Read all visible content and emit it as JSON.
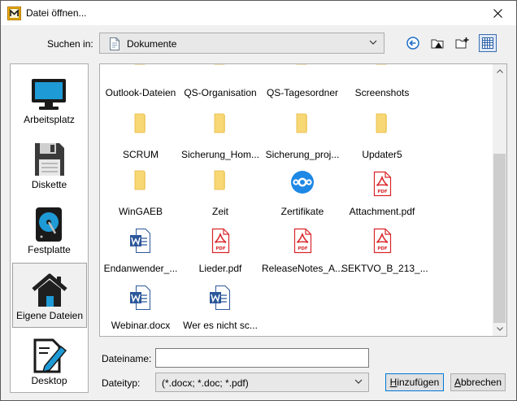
{
  "window": {
    "title": "Datei öffnen..."
  },
  "lookin": {
    "label": "Suchen in:",
    "value": "Dokumente"
  },
  "places": [
    {
      "label": "Arbeitsplatz",
      "icon": "monitor-icon"
    },
    {
      "label": "Diskette",
      "icon": "floppy-disk-icon"
    },
    {
      "label": "Festplatte",
      "icon": "hard-disk-icon"
    },
    {
      "label": "Eigene Dateien",
      "icon": "home-icon",
      "selected": true
    },
    {
      "label": "Desktop",
      "icon": "desktop-pen-icon"
    }
  ],
  "files": [
    {
      "name": "Outlook-Dateien",
      "type": "folder"
    },
    {
      "name": "QS-Organisation",
      "type": "folder"
    },
    {
      "name": "QS-Tagesordner",
      "type": "folder"
    },
    {
      "name": "Screenshots",
      "type": "folder"
    },
    {
      "name": "SCRUM",
      "type": "folder"
    },
    {
      "name": "Sicherung_Hom...",
      "type": "folder"
    },
    {
      "name": "Sicherung_proj...",
      "type": "folder"
    },
    {
      "name": "Updater5",
      "type": "folder"
    },
    {
      "name": "WinGAEB",
      "type": "folder"
    },
    {
      "name": "Zeit",
      "type": "folder"
    },
    {
      "name": "Zertifikate",
      "type": "app"
    },
    {
      "name": "Attachment.pdf",
      "type": "pdf"
    },
    {
      "name": "Endanwender_...",
      "type": "word"
    },
    {
      "name": "Lieder.pdf",
      "type": "pdf"
    },
    {
      "name": "ReleaseNotes_A...",
      "type": "pdf"
    },
    {
      "name": "SEKTVO_B_213_...",
      "type": "pdf"
    },
    {
      "name": "Webinar.docx",
      "type": "word"
    },
    {
      "name": "Wer es nicht sc...",
      "type": "word"
    }
  ],
  "filename": {
    "label": "Dateiname:",
    "value": ""
  },
  "filetype": {
    "label": "Dateityp:",
    "value": "(*.docx; *.doc; *.pdf)"
  },
  "buttons": {
    "add_hotkey": "H",
    "add_rest": "inzufügen",
    "cancel_hotkey": "A",
    "cancel_rest": "bbrechen"
  },
  "colors": {
    "folder": "#f8d775",
    "pdf_red": "#d9262a",
    "word_blue": "#2b579a",
    "app_blue": "#1e88e5",
    "accent": "#0078d7"
  }
}
